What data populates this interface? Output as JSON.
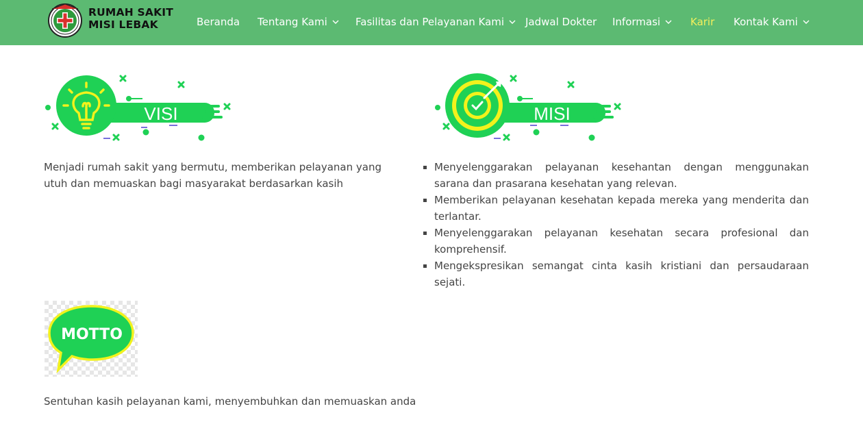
{
  "brand": {
    "line1": "RUMAH SAKIT",
    "line2": "MISI LEBAK"
  },
  "nav": {
    "items": [
      {
        "label": "Beranda",
        "dropdown": false,
        "active": false
      },
      {
        "label": "Tentang Kami",
        "dropdown": true,
        "active": false
      },
      {
        "label": "Fasilitas dan Pelayanan Kami",
        "dropdown": true,
        "active": false
      },
      {
        "label": "Jadwal Dokter",
        "dropdown": false,
        "active": false
      },
      {
        "label": "Informasi",
        "dropdown": true,
        "active": false
      },
      {
        "label": "Karir",
        "dropdown": false,
        "active": true
      },
      {
        "label": "Kontak Kami",
        "dropdown": true,
        "active": false
      }
    ]
  },
  "visi": {
    "banner_label": "VISI",
    "text": "Menjadi rumah sakit yang bermutu, memberikan pelayanan yang utuh dan memuaskan bagi masyarakat berdasarkan kasih"
  },
  "misi": {
    "banner_label": "MISI",
    "items": [
      "Menyelenggarakan pelayanan kesehantan dengan menggunakan sarana dan prasarana kesehatan yang relevan.",
      "Memberikan pelayanan kesehatan kepada mereka yang menderita dan terlantar.",
      "Menyelenggarakan pelayanan kesehatan secara profesional dan komprehensif.",
      "Mengekspresikan semangat cinta kasih kristiani dan persaudaraan sejati."
    ]
  },
  "motto": {
    "bubble_label": "MOTTO",
    "text": "Sentuhan kasih pelayanan kami, menyembuhkan dan memuaskan anda"
  },
  "colors": {
    "navbar": "#5cba72",
    "nav_text": "#ffffff",
    "nav_active": "#f4f05c",
    "art_green": "#1fd155",
    "art_yellow": "#f2f21c",
    "body_text": "#444444"
  },
  "icons": {
    "logo": "hospital-emblem-icon",
    "dropdown": "chevron-down-icon",
    "visi": "lightbulb-icon",
    "misi": "target-icon"
  }
}
